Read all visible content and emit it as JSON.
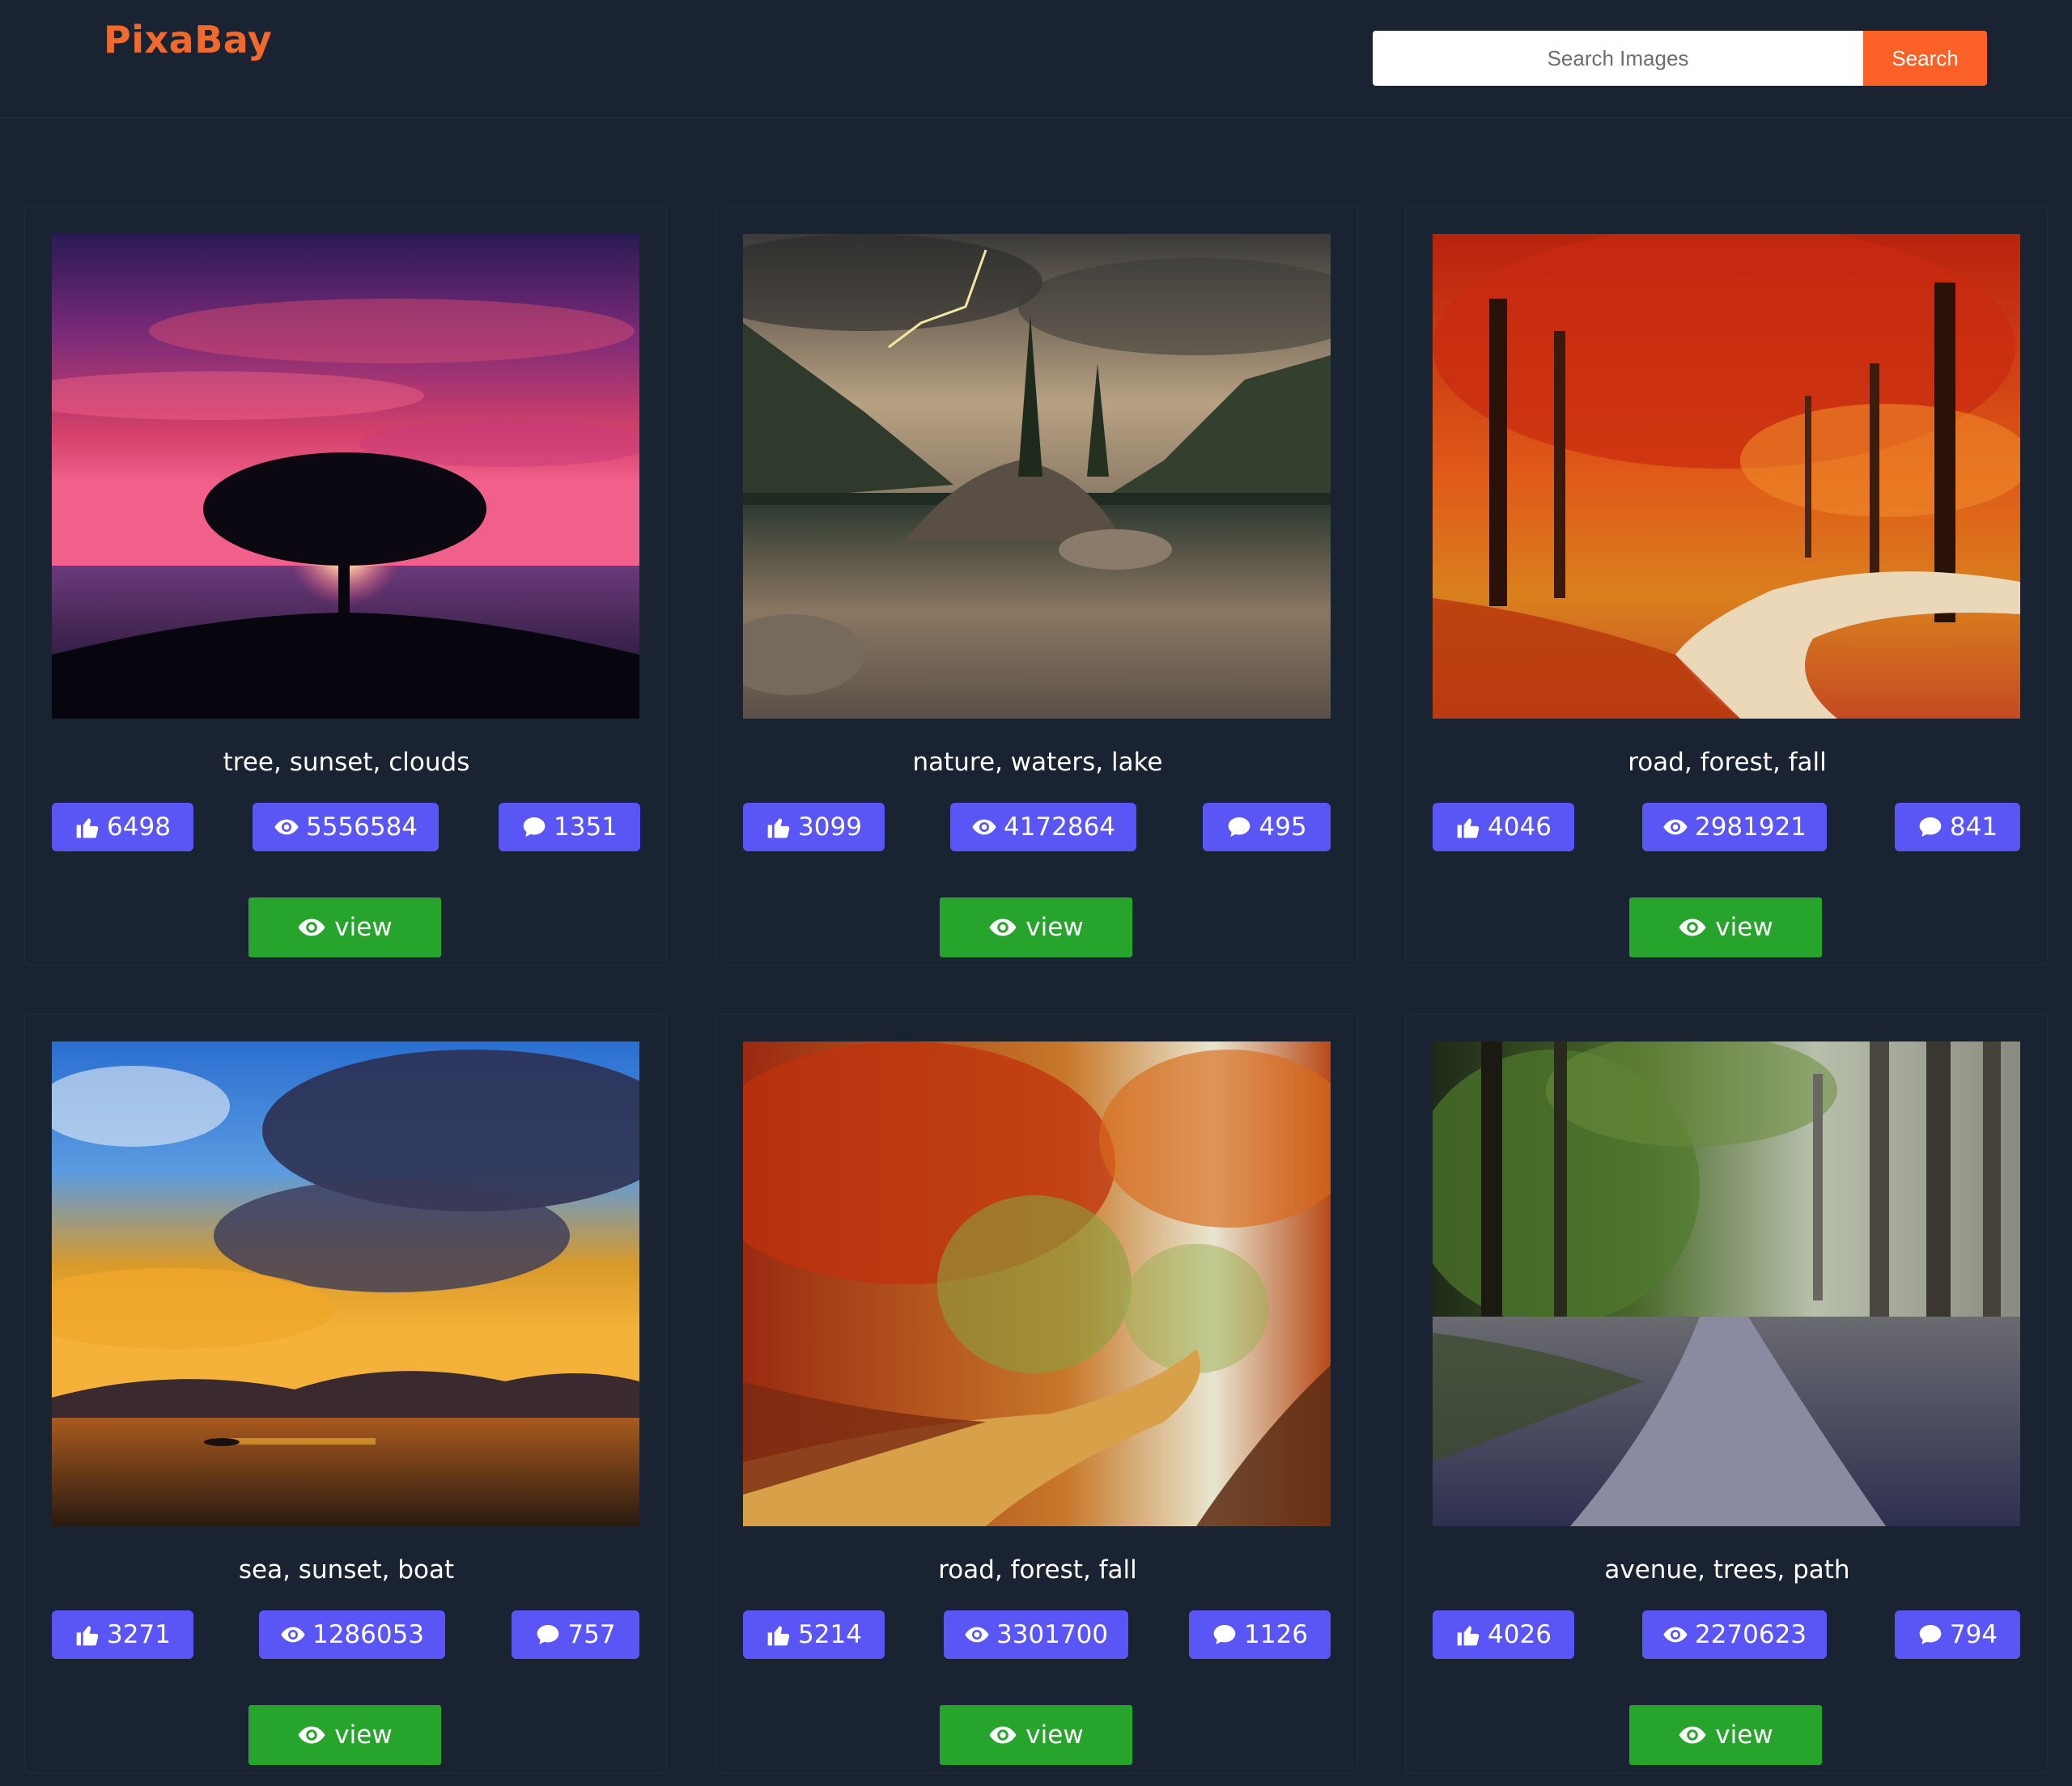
{
  "header": {
    "logo": "PixaBay",
    "search_placeholder": "Search Images",
    "search_button": "Search"
  },
  "colors": {
    "background": "#1a2331",
    "logo": "#ef6a2c",
    "search_button": "#fb6126",
    "stat_badge": "#5a55f5",
    "view_button": "#26a42b"
  },
  "icons": {
    "likes": "thumbs-up-icon",
    "views": "eye-icon",
    "comments": "comment-icon",
    "view_button": "eye-icon"
  },
  "cards": [
    {
      "tags": "tree, sunset, clouds",
      "likes": "6498",
      "views": "5556584",
      "comments": "1351",
      "button": "view"
    },
    {
      "tags": "nature, waters, lake",
      "likes": "3099",
      "views": "4172864",
      "comments": "495",
      "button": "view"
    },
    {
      "tags": "road, forest, fall",
      "likes": "4046",
      "views": "2981921",
      "comments": "841",
      "button": "view"
    },
    {
      "tags": "sea, sunset, boat",
      "likes": "3271",
      "views": "1286053",
      "comments": "757",
      "button": "view"
    },
    {
      "tags": "road, forest, fall",
      "likes": "5214",
      "views": "3301700",
      "comments": "1126",
      "button": "view"
    },
    {
      "tags": "avenue, trees, path",
      "likes": "4026",
      "views": "2270623",
      "comments": "794",
      "button": "view"
    }
  ]
}
